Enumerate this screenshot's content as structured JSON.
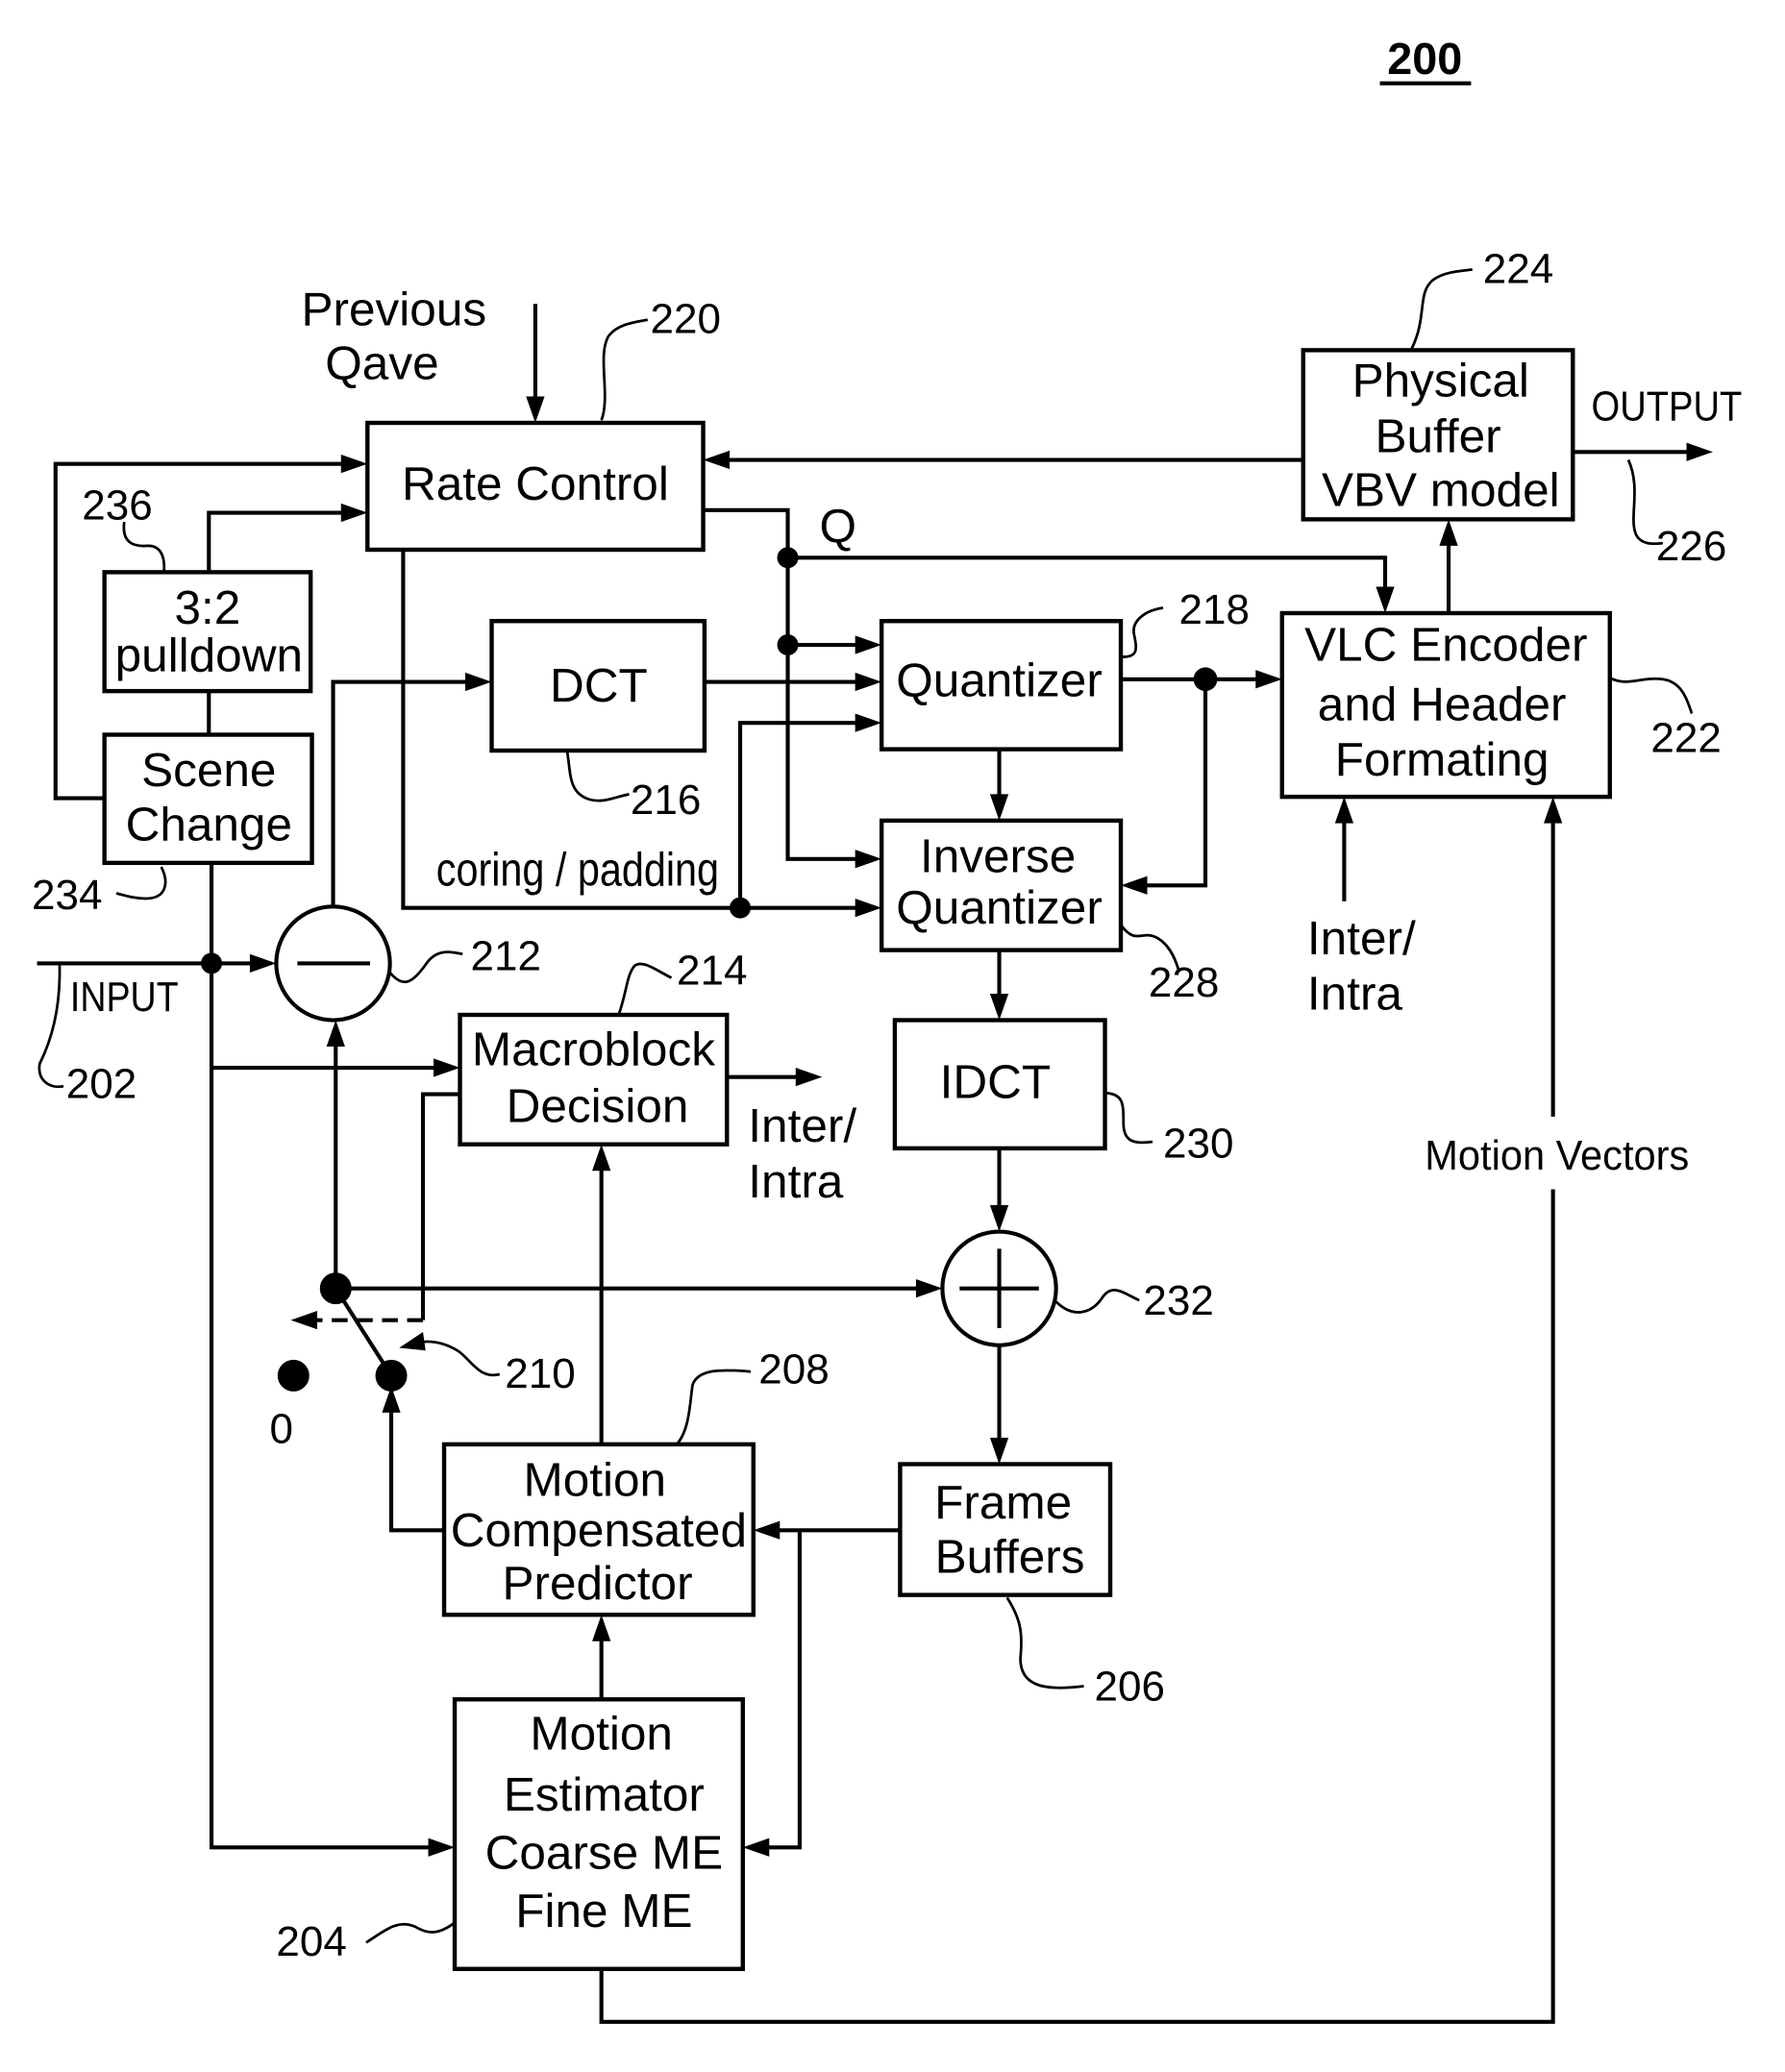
{
  "figure": {
    "number": "200"
  },
  "blocks": {
    "rate_control": {
      "label": [
        "Rate  Control"
      ],
      "ref": "220"
    },
    "physical_buffer": {
      "label": [
        "Physical",
        "Buffer",
        "VBV model"
      ],
      "ref": "224"
    },
    "pulldown": {
      "label": [
        "3:2",
        "pulldown"
      ],
      "ref": "236"
    },
    "scene_change": {
      "label": [
        "Scene",
        "Change"
      ],
      "ref": "234"
    },
    "dct": {
      "label": [
        "DCT"
      ],
      "ref": "216"
    },
    "quantizer": {
      "label": [
        "Quantizer"
      ],
      "ref": "218"
    },
    "vlc_encoder": {
      "label": [
        "VLC Encoder",
        "and Header",
        "Formating"
      ],
      "ref": "222"
    },
    "inverse_quantizer": {
      "label": [
        "Inverse",
        "Quantizer"
      ],
      "ref": "228"
    },
    "idct": {
      "label": [
        "IDCT"
      ],
      "ref": "230"
    },
    "macroblock_decision": {
      "label": [
        "Macroblock",
        "Decision"
      ],
      "ref": "214"
    },
    "frame_buffers": {
      "label": [
        "Frame",
        "Buffers"
      ],
      "ref": "206"
    },
    "motion_compensated_predictor": {
      "label": [
        "Motion",
        "Compensated",
        "Predictor"
      ],
      "ref": "208"
    },
    "motion_estimator": {
      "label": [
        "Motion",
        "Estimator",
        "Coarse ME",
        "Fine ME"
      ],
      "ref": "204"
    }
  },
  "operators": {
    "subtractor": {
      "symbol": "minus",
      "ref": "212"
    },
    "adder": {
      "symbol": "plus",
      "ref": "232"
    },
    "switch": {
      "ref": "210",
      "zero_label": "0"
    }
  },
  "signals": {
    "previous_qave": [
      "Previous",
      "Qave"
    ],
    "output": "OUTPUT",
    "output_ref": "226",
    "input": "INPUT",
    "input_ref": "202",
    "q": "Q",
    "coring_padding": "coring / padding",
    "inter_intra_mb": [
      "Inter/",
      "Intra"
    ],
    "inter_intra_vlc": [
      "Inter/",
      "Intra"
    ],
    "motion_vectors": "Motion Vectors"
  }
}
